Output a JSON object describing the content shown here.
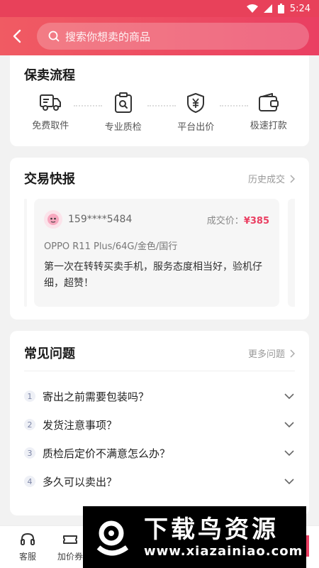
{
  "status_bar": {
    "time": "5:24"
  },
  "header": {
    "search_placeholder": "搜索你想卖的商品"
  },
  "process": {
    "title": "保卖流程",
    "steps": [
      {
        "label": "免费取件",
        "icon": "truck-icon"
      },
      {
        "label": "专业质检",
        "icon": "inspection-icon"
      },
      {
        "label": "平台出价",
        "icon": "yuan-shield-icon"
      },
      {
        "label": "极速打款",
        "icon": "wallet-icon"
      }
    ]
  },
  "trades": {
    "title": "交易快报",
    "history_link": "历史成交",
    "item": {
      "phone": "159****5484",
      "price_label": "成交价：",
      "price": "¥385",
      "model": "OPPO R11 Plus/64G/金色/国行",
      "comment": "第一次在转转买卖手机，服务态度相当好，验机仔细，超赞！"
    }
  },
  "faq": {
    "title": "常见问题",
    "more_link": "更多问题",
    "items": [
      {
        "num": "1",
        "question": "寄出之前需要包装吗？"
      },
      {
        "num": "2",
        "question": "发货注意事项？"
      },
      {
        "num": "3",
        "question": "质检后定价不满意怎么办？"
      },
      {
        "num": "4",
        "question": "多久可以卖出？"
      }
    ]
  },
  "bottom_bar": {
    "service_label": "客服",
    "coupon_label": "加价券"
  },
  "watermark": {
    "title": "下载鸟资源",
    "url": "www.xiazainiao.com"
  },
  "colors": {
    "accent": "#ea3f62",
    "header_start": "#f05b63"
  }
}
